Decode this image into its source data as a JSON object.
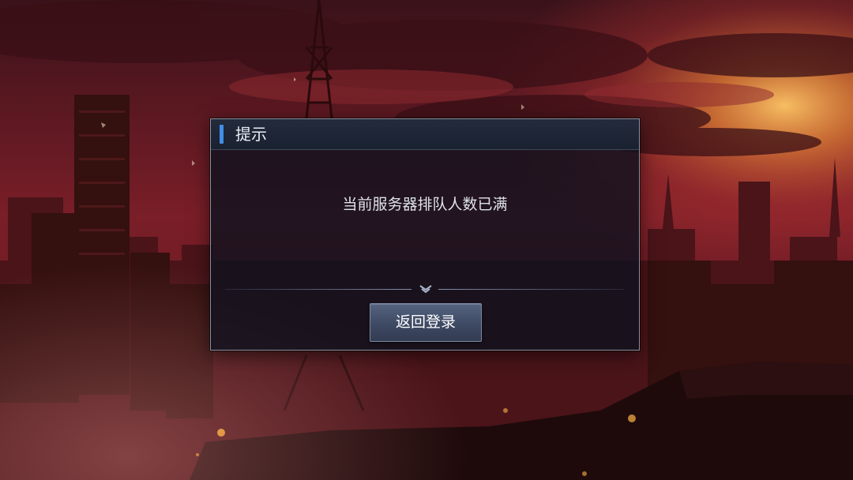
{
  "dialog": {
    "title": "提示",
    "message": "当前服务器排队人数已满",
    "confirm_button_label": "返回登录"
  },
  "colors": {
    "header_accent": "#3f8ee6",
    "dialog_background": "#0c111e",
    "button_background": "#46536d",
    "sky_red": "#b8313a",
    "sun_glow": "#f2a23a"
  },
  "icons": {
    "divider_emblem": "double-chevron-down-icon"
  }
}
